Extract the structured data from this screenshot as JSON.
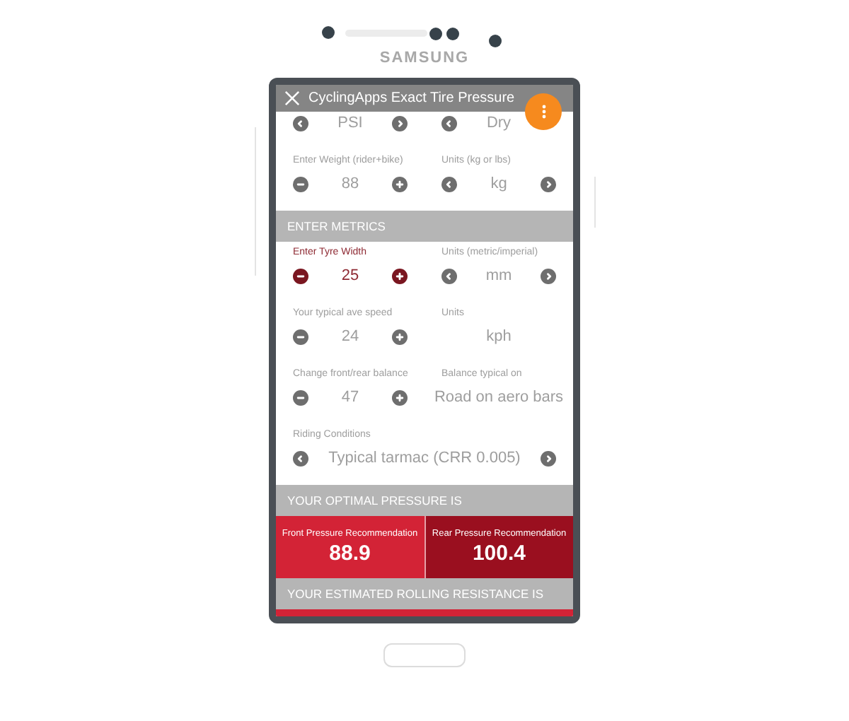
{
  "device": {
    "brand": "SAMSUNG"
  },
  "app_bar": {
    "title": "CyclingApps Exact Tire Pressure"
  },
  "blocks": [
    {
      "kind": "pair",
      "active": false,
      "cells": [
        {
          "kind": "selector",
          "value": "PSI"
        },
        {
          "kind": "selector_covered",
          "value": "Dry"
        }
      ]
    },
    {
      "kind": "pair",
      "active": false,
      "cells": [
        {
          "label": "Enter Weight (rider+bike)",
          "kind": "stepper",
          "value": "88"
        },
        {
          "label": "Units (kg or lbs)",
          "kind": "selector",
          "value": "kg"
        }
      ]
    },
    {
      "kind": "header",
      "text": "ENTER METRICS"
    },
    {
      "kind": "pair",
      "active": true,
      "cells": [
        {
          "label": "Enter Tyre Width",
          "kind": "stepper",
          "value": "25"
        },
        {
          "label": "Units (metric/imperial)",
          "kind": "selector",
          "value": "mm"
        }
      ]
    },
    {
      "kind": "pair",
      "active": false,
      "cells": [
        {
          "label": "Your typical ave speed",
          "kind": "stepper",
          "value": "24"
        },
        {
          "label": "Units",
          "kind": "static",
          "value": "kph"
        }
      ]
    },
    {
      "kind": "pair",
      "active": false,
      "cells": [
        {
          "label": "Change front/rear balance",
          "kind": "stepper",
          "value": "47"
        },
        {
          "label": "Balance typical on",
          "kind": "static",
          "value": "Road on aero bars"
        }
      ]
    },
    {
      "kind": "wide",
      "active": false,
      "cells": [
        {
          "label": "Riding Conditions",
          "kind": "selector",
          "value": "Typical tarmac (CRR 0.005)"
        }
      ]
    },
    {
      "kind": "header",
      "text": "YOUR OPTIMAL PRESSURE IS"
    },
    {
      "kind": "results",
      "items": [
        {
          "label": "Front Pressure Recommendation",
          "value": "88.9",
          "color": "#d32336"
        },
        {
          "label": "Rear Pressure Recommendation",
          "value": "100.4",
          "color": "#9a0f1f"
        }
      ]
    },
    {
      "kind": "header",
      "text": "YOUR ESTIMATED ROLLING RESISTANCE IS"
    },
    {
      "kind": "band",
      "color": "#d32336"
    }
  ]
}
